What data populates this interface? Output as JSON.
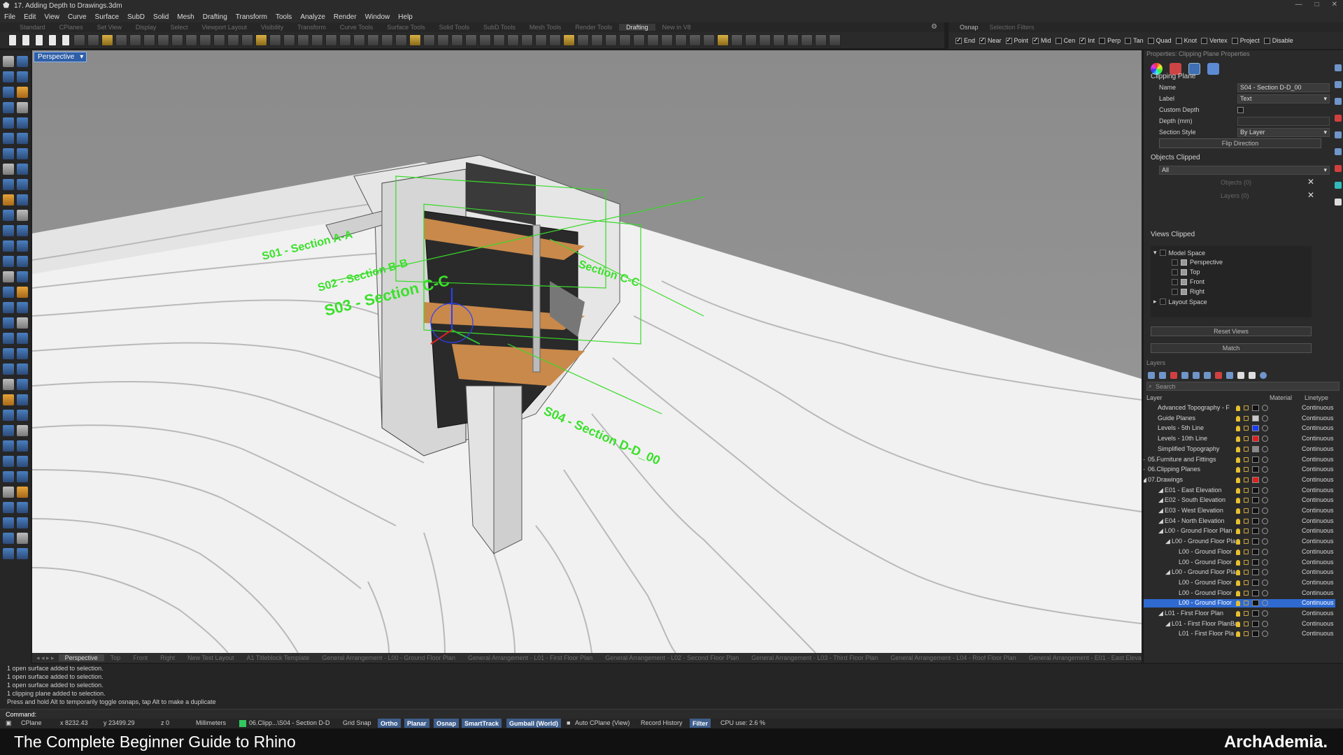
{
  "window": {
    "title": "17. Adding Depth to Drawings.3dm",
    "app_icon": "rhino-icon"
  },
  "menu": [
    "File",
    "Edit",
    "View",
    "Curve",
    "Surface",
    "SubD",
    "Solid",
    "Mesh",
    "Drafting",
    "Transform",
    "Tools",
    "Analyze",
    "Render",
    "Window",
    "Help"
  ],
  "toolbar_tabs": {
    "items": [
      "Standard",
      "CPlanes",
      "Set View",
      "Display",
      "Select",
      "Viewport Layout",
      "Visibility",
      "Transform",
      "Curve Tools",
      "Surface Tools",
      "Solid Tools",
      "SubD Tools",
      "Mesh Tools",
      "Render Tools",
      "Drafting",
      "New in V8"
    ],
    "active": "Drafting"
  },
  "osnap": {
    "tab_label": "Osnap",
    "filter_label": "Selection Filters",
    "items": [
      {
        "label": "End",
        "checked": true
      },
      {
        "label": "Near",
        "checked": true
      },
      {
        "label": "Point",
        "checked": true
      },
      {
        "label": "Mid",
        "checked": true
      },
      {
        "label": "Cen",
        "checked": false
      },
      {
        "label": "Int",
        "checked": true
      },
      {
        "label": "Perp",
        "checked": false
      },
      {
        "label": "Tan",
        "checked": false
      },
      {
        "label": "Quad",
        "checked": false
      },
      {
        "label": "Knot",
        "checked": false
      },
      {
        "label": "Vertex",
        "checked": false
      },
      {
        "label": "Project",
        "checked": false
      },
      {
        "label": "Disable",
        "checked": false
      }
    ]
  },
  "viewport": {
    "label": "Perspective",
    "labels_3d": [
      "S01 - Section A-A",
      "S02 - Section B-B",
      "S03 - Section C-C",
      "S04 - Section D-D_00",
      "Section C-C"
    ],
    "colors": {
      "background": "#939393",
      "section": "#39d92a"
    }
  },
  "viewport_tabs": {
    "items": [
      "Perspective",
      "Top",
      "Front",
      "Right",
      "New Test Layout",
      "A1 Titleblock Template",
      "General Arrangement - L00 - Ground Floor Plan",
      "General Arrangement - L01 - First Floor Plan",
      "General Arrangement - L02 - Second Floor Plan",
      "General Arrangement - L03 - Third Floor Plan",
      "General Arrangement - L04 - Roof Floor Plan",
      "General Arrangement - E01 - East Elevation",
      "General Arra"
    ],
    "active": "Perspective"
  },
  "properties": {
    "panel_title": "Properties: Clipping Plane Properties",
    "section_title": "Clipping Plane",
    "name_label": "Name",
    "name_value": "S04 - Section D-D_00",
    "label_label": "Label",
    "label_value": "Text",
    "custom_depth_label": "Custom Depth",
    "depth_label": "Depth (mm)",
    "depth_value": "",
    "section_style_label": "Section Style",
    "section_style_value": "By Layer",
    "flip_button": "Flip Direction",
    "objects_clipped_title": "Objects Clipped",
    "objects_clipped_value": "All",
    "objects_count": "Objects (0)",
    "layers_count": "Layers (0)",
    "views_clipped_title": "Views Clipped",
    "tree": {
      "model_space": "Model Space",
      "views": [
        "Perspective",
        "Top",
        "Front",
        "Right"
      ],
      "layout_space": "Layout Space"
    },
    "reset_views_button": "Reset Views",
    "match_button": "Match"
  },
  "layers": {
    "panel_title": "Layers",
    "search_placeholder": "Search",
    "col_layer": "Layer",
    "col_material": "Material",
    "col_linetype": "Linetype",
    "rows": [
      {
        "name": "Advanced Topography - F",
        "indent": 0,
        "color": "#111111",
        "linetype": "Continuous",
        "selected": false
      },
      {
        "name": "Guide Planes",
        "indent": 0,
        "color": "#c8c8c8",
        "linetype": "Continuous",
        "selected": false
      },
      {
        "name": "Levels - 5th Line",
        "indent": 0,
        "color": "#1a3cff",
        "linetype": "Continuous",
        "selected": false
      },
      {
        "name": "Levels - 10th Line",
        "indent": 0,
        "color": "#e02020",
        "linetype": "Continuous",
        "selected": false
      },
      {
        "name": "Simplified Topography",
        "indent": 0,
        "color": "#8a8a8a",
        "linetype": "Continuous",
        "selected": false
      },
      {
        "name": "05.Furniture and Fittings",
        "indent": -1,
        "color": "#111111",
        "linetype": "Continuous",
        "selected": false
      },
      {
        "name": "06.Clipping Planes",
        "indent": -1,
        "color": "#111111",
        "linetype": "Continuous",
        "selected": false
      },
      {
        "name": "07.Drawings",
        "indent": -1,
        "color": "#e02020",
        "linetype": "Continuous",
        "selected": false
      },
      {
        "name": "E01 - East Elevation",
        "indent": 1,
        "color": "#111111",
        "linetype": "Continuous",
        "selected": false
      },
      {
        "name": "E02 - South Elevation",
        "indent": 1,
        "color": "#111111",
        "linetype": "Continuous",
        "selected": false
      },
      {
        "name": "E03 - West Elevation",
        "indent": 1,
        "color": "#111111",
        "linetype": "Continuous",
        "selected": false
      },
      {
        "name": "E04 - North Elevation",
        "indent": 1,
        "color": "#111111",
        "linetype": "Continuous",
        "selected": false
      },
      {
        "name": "L00 - Ground Floor Plan",
        "indent": 1,
        "color": "#111111",
        "linetype": "Continuous",
        "selected": false
      },
      {
        "name": "L00 - Ground Floor Pla",
        "indent": 2,
        "color": "#111111",
        "linetype": "Continuous",
        "selected": false
      },
      {
        "name": "L00 - Ground Floor",
        "indent": 3,
        "color": "#111111",
        "linetype": "Continuous",
        "selected": false
      },
      {
        "name": "L00 - Ground Floor",
        "indent": 3,
        "color": "#111111",
        "linetype": "Continuous",
        "selected": false
      },
      {
        "name": "L00 - Ground Floor Pla",
        "indent": 2,
        "color": "#111111",
        "linetype": "Continuous",
        "selected": false
      },
      {
        "name": "L00 - Ground Floor",
        "indent": 3,
        "color": "#111111",
        "linetype": "Continuous",
        "selected": false
      },
      {
        "name": "L00 - Ground Floor",
        "indent": 3,
        "color": "#111111",
        "linetype": "Continuous",
        "selected": false
      },
      {
        "name": "L00 - Ground Floor",
        "indent": 3,
        "color": "#111111",
        "linetype": "Continuous",
        "selected": true
      },
      {
        "name": "L01 - First Floor Plan",
        "indent": 1,
        "color": "#111111",
        "linetype": "Continuous",
        "selected": false
      },
      {
        "name": "L01 - First Floor PlanBa",
        "indent": 2,
        "color": "#111111",
        "linetype": "Continuous",
        "selected": false
      },
      {
        "name": "L01 - First Floor Pla",
        "indent": 3,
        "color": "#111111",
        "linetype": "Continuous",
        "selected": false
      }
    ]
  },
  "command_history": [
    "1 open surface added to selection.",
    "1 open surface added to selection.",
    "1 open surface added to selection.",
    "1 clipping plane added to selection.",
    "Press and hold Alt to temporarily toggle osnaps, tap Alt to make a duplicate"
  ],
  "command_prompt": "Command:",
  "status": {
    "cplane": "CPlane",
    "x": "x 8232.43",
    "y": "y 23499.29",
    "z": "z 0",
    "units": "Millimeters",
    "layer": "06.Clipp...\\S04 - Section D-D",
    "grid_snap": "Grid Snap",
    "ortho": "Ortho",
    "planar": "Planar",
    "osnap": "Osnap",
    "smarttrack": "SmartTrack",
    "gumball": "Gumball (World)",
    "auto_cplane": "Auto CPlane (View)",
    "record_history": "Record History",
    "filter": "Filter",
    "cpu": "CPU use: 2.6 %"
  },
  "caption": {
    "left": "The Complete Beginner Guide to Rhino",
    "right": "ArchAdemia."
  }
}
